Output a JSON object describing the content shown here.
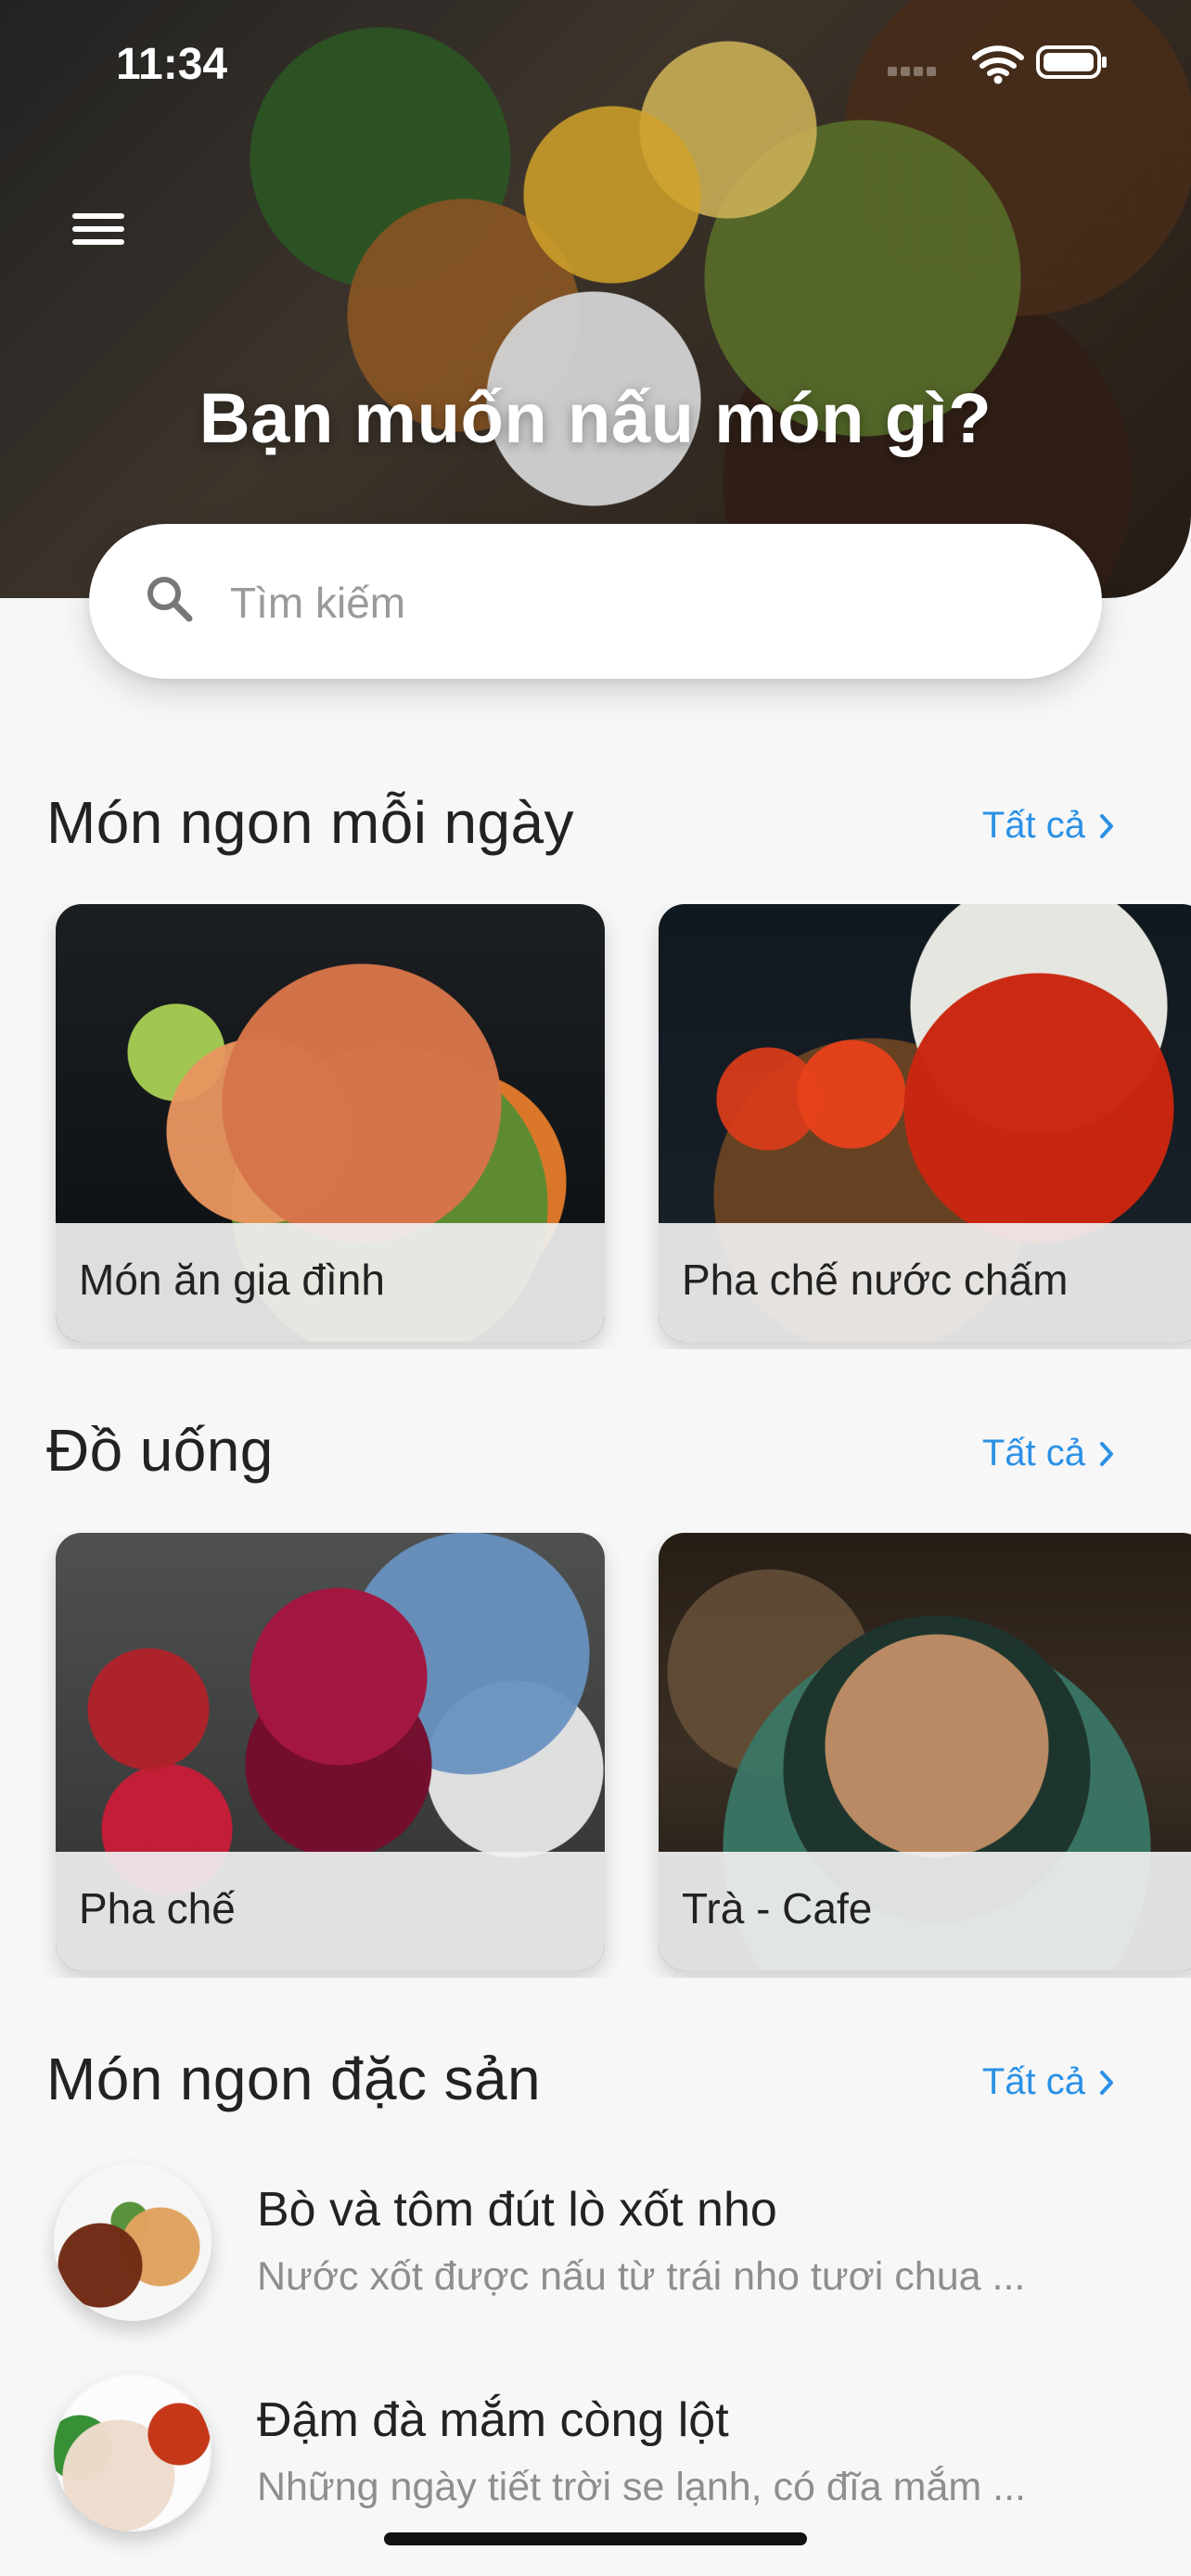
{
  "status_bar": {
    "time": "11:34"
  },
  "header": {
    "title": "Bạn muốn nấu món gì?",
    "menu_icon": "menu-icon"
  },
  "search": {
    "placeholder": "Tìm kiếm",
    "value": ""
  },
  "sections": {
    "daily": {
      "title": "Món ngon mỗi ngày",
      "see_all": "Tất cả",
      "items": [
        {
          "label": "Món ăn gia đình"
        },
        {
          "label": "Pha chế nước chấm"
        }
      ]
    },
    "drinks": {
      "title": "Đồ uống",
      "see_all": "Tất cả",
      "items": [
        {
          "label": "Pha chế"
        },
        {
          "label": "Trà - Cafe"
        }
      ]
    },
    "specialties": {
      "title": "Món ngon đặc sản",
      "see_all": "Tất cả",
      "items": [
        {
          "title": "Bò và tôm đút lò xốt nho",
          "description": "Nước xốt được nấu từ trái nho tươi chua ..."
        },
        {
          "title": "Đậm đà mắm còng lột",
          "description": "Những ngày tiết trời se lạnh, có đĩa mắm ..."
        }
      ]
    }
  },
  "colors": {
    "accent": "#2b91e6",
    "background": "#f7f7f7",
    "text": "#222222",
    "muted_text": "#8e8e8e"
  }
}
